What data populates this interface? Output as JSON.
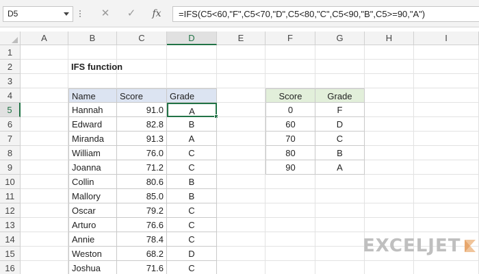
{
  "formula_bar": {
    "name_box": "D5",
    "cancel_glyph": "✕",
    "enter_glyph": "✓",
    "fx_label": "fx",
    "formula": "=IFS(C5<60,\"F\",C5<70,\"D\",C5<80,\"C\",C5<90,\"B\",C5>=90,\"A\")"
  },
  "columns": [
    "A",
    "B",
    "C",
    "D",
    "E",
    "F",
    "G",
    "H",
    "I"
  ],
  "active_column": "D",
  "active_row": 5,
  "rows": [
    "1",
    "2",
    "3",
    "4",
    "5",
    "6",
    "7",
    "8",
    "9",
    "10",
    "11",
    "12",
    "13",
    "14",
    "15",
    "16"
  ],
  "title": "IFS function",
  "main_table": {
    "headers": [
      "Name",
      "Score",
      "Grade"
    ],
    "rows": [
      [
        "Hannah",
        "91.0",
        "A"
      ],
      [
        "Edward",
        "82.8",
        "B"
      ],
      [
        "Miranda",
        "91.3",
        "A"
      ],
      [
        "William",
        "76.0",
        "C"
      ],
      [
        "Joanna",
        "71.2",
        "C"
      ],
      [
        "Collin",
        "80.6",
        "B"
      ],
      [
        "Mallory",
        "85.0",
        "B"
      ],
      [
        "Oscar",
        "79.2",
        "C"
      ],
      [
        "Arturo",
        "76.6",
        "C"
      ],
      [
        "Annie",
        "78.4",
        "C"
      ],
      [
        "Weston",
        "68.2",
        "D"
      ],
      [
        "Joshua",
        "71.6",
        "C"
      ]
    ]
  },
  "lookup_table": {
    "headers": [
      "Score",
      "Grade"
    ],
    "rows": [
      [
        "0",
        "F"
      ],
      [
        "60",
        "D"
      ],
      [
        "70",
        "C"
      ],
      [
        "80",
        "B"
      ],
      [
        "90",
        "A"
      ]
    ]
  },
  "logo": {
    "text": "EXCELJET",
    "color": "#bfbfbf",
    "accent": "#f0c49a"
  },
  "colors": {
    "selection": "#217346",
    "header_blue": "#dce4f2",
    "header_green": "#e2efda"
  }
}
